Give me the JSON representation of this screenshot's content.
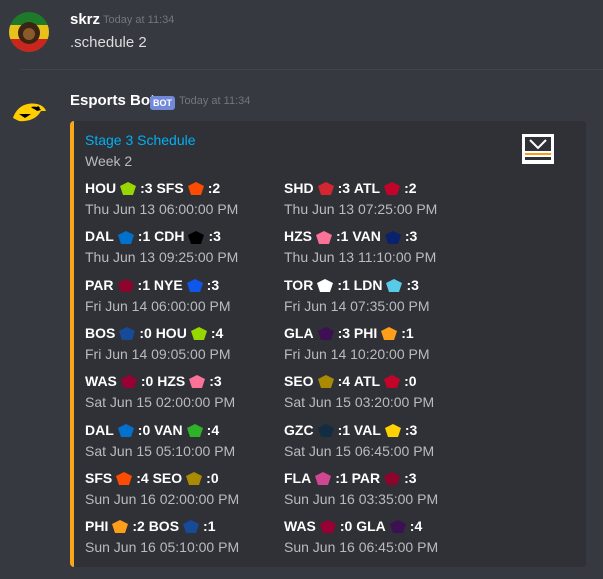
{
  "colors": {
    "background": "#36393f",
    "embed_bg": "#2f3136",
    "embed_accent": "#faa61a",
    "link": "#00b0f4",
    "bot_tag": "#7289da"
  },
  "messages": [
    {
      "username": "skrz",
      "timestamp": "Today at 11:34",
      "content": ".schedule 2",
      "avatar_icon": "rasta-lion-avatar-icon"
    },
    {
      "username": "Esports Bot",
      "bot_tag": "BOT",
      "timestamp": "Today at 11:34",
      "avatar_icon": "hawkeye-avatar-icon"
    }
  ],
  "embed": {
    "title": "Stage 3 Schedule",
    "subtitle": "Week 2",
    "thumbnail_icon": "overwatch-league-logo-icon",
    "thumbnail_text": "OVERWATCH LEAGUE",
    "matches": [
      {
        "team1": "HOU",
        "score1": "3",
        "team2": "SFS",
        "score2": "2",
        "time": "Thu Jun 13 06:00:00 PM",
        "logo1": "#97d700",
        "logo2": "#fc4c02"
      },
      {
        "team1": "SHD",
        "score1": "3",
        "team2": "ATL",
        "score2": "2",
        "time": "Thu Jun 13 07:25:00 PM",
        "logo1": "#d22630",
        "logo2": "#c4032b"
      },
      {
        "team1": "DAL",
        "score1": "1",
        "team2": "CDH",
        "score2": "3",
        "time": "Thu Jun 13 09:25:00 PM",
        "logo1": "#0072ce",
        "logo2": "#000000"
      },
      {
        "team1": "HZS",
        "score1": "1",
        "team2": "VAN",
        "score2": "3",
        "time": "Thu Jun 13 11:10:00 PM",
        "logo1": "#fb7299",
        "logo2": "#09226b"
      },
      {
        "team1": "PAR",
        "score1": "1",
        "team2": "NYE",
        "score2": "3",
        "time": "Fri Jun 14 06:00:00 PM",
        "logo1": "#8d042d",
        "logo2": "#0f57ea"
      },
      {
        "team1": "TOR",
        "score1": "1",
        "team2": "LDN",
        "score2": "3",
        "time": "Fri Jun 14 07:35:00 PM",
        "logo1": "#ffffff",
        "logo2": "#59cbe8"
      },
      {
        "team1": "BOS",
        "score1": "0",
        "team2": "HOU",
        "score2": "4",
        "time": "Fri Jun 14 09:05:00 PM",
        "logo1": "#174b97",
        "logo2": "#97d700"
      },
      {
        "team1": "GLA",
        "score1": "3",
        "team2": "PHI",
        "score2": "1",
        "time": "Fri Jun 14 10:20:00 PM",
        "logo1": "#3c1053",
        "logo2": "#ff9e1b"
      },
      {
        "team1": "WAS",
        "score1": "0",
        "team2": "HZS",
        "score2": "3",
        "time": "Sat Jun 15 02:00:00 PM",
        "logo1": "#990034",
        "logo2": "#fb7299"
      },
      {
        "team1": "SEO",
        "score1": "4",
        "team2": "ATL",
        "score2": "0",
        "time": "Sat Jun 15 03:20:00 PM",
        "logo1": "#aa8a00",
        "logo2": "#c4032b"
      },
      {
        "team1": "DAL",
        "score1": "0",
        "team2": "VAN",
        "score2": "4",
        "time": "Sat Jun 15 05:10:00 PM",
        "logo1": "#0072ce",
        "logo2": "#2fb228"
      },
      {
        "team1": "GZC",
        "score1": "1",
        "team2": "VAL",
        "score2": "3",
        "time": "Sat Jun 15 06:45:00 PM",
        "logo1": "#122c42",
        "logo2": "#ffd100"
      },
      {
        "team1": "SFS",
        "score1": "4",
        "team2": "SEO",
        "score2": "0",
        "time": "Sun Jun 16 02:00:00 PM",
        "logo1": "#fc4c02",
        "logo2": "#aa8a00"
      },
      {
        "team1": "FLA",
        "score1": "1",
        "team2": "PAR",
        "score2": "3",
        "time": "Sun Jun 16 03:35:00 PM",
        "logo1": "#cf4691",
        "logo2": "#8d042d"
      },
      {
        "team1": "PHI",
        "score1": "2",
        "team2": "BOS",
        "score2": "1",
        "time": "Sun Jun 16 05:10:00 PM",
        "logo1": "#ff9e1b",
        "logo2": "#174b97"
      },
      {
        "team1": "WAS",
        "score1": "0",
        "team2": "GLA",
        "score2": "4",
        "time": "Sun Jun 16 06:45:00 PM",
        "logo1": "#990034",
        "logo2": "#3c1053"
      }
    ]
  }
}
